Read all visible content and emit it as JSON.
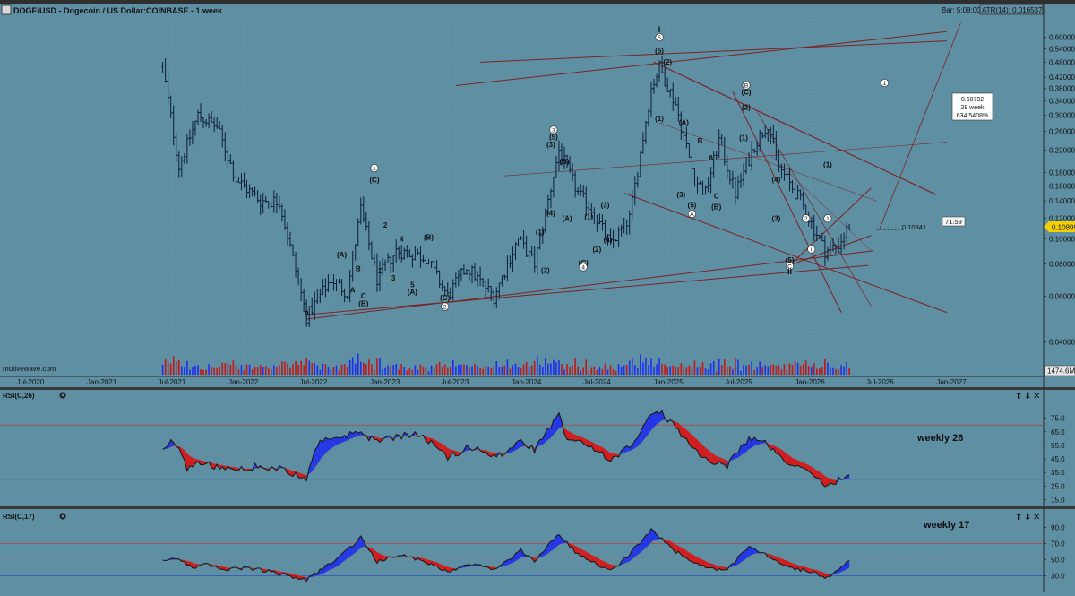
{
  "header": {
    "title": "DOGE/USD - Dogecoin / US Dollar:COINBASE - 1 week",
    "bar_label": "Bar: 5:08:00",
    "atr_label": "ATR(14): 0.016537"
  },
  "watermark": "motivewave.com",
  "colors": {
    "background": "#5f8fa3",
    "candle": "#0b1e3a",
    "channel": "#7a2424",
    "rsi_line": "#1a1a1a",
    "rsi_up": "#1e2ef0",
    "rsi_down": "#e01010",
    "level_line": "#b84040",
    "mid_line": "#2c4fbf"
  },
  "chart_data": [
    {
      "type": "candlestick",
      "title": "DOGE/USD - Dogecoin / US Dollar:COINBASE - 1 week",
      "y_scale": "log",
      "ylim": [
        0.034,
        0.7
      ],
      "x_range": [
        "2020-06-01",
        "2027-02-28"
      ],
      "x_ticks": [
        "Jul-2020",
        "Jan-2021",
        "Jul-2021",
        "Jan-2022",
        "Jul-2022",
        "Jan-2023",
        "Jul-2023",
        "Jan-2024",
        "Jul-2024",
        "Jan-2025",
        "Jul-2025",
        "Jan-2026",
        "Jul-2026",
        "Jan-2027"
      ],
      "y_ticks": [
        "0.04000",
        "0.06000",
        "0.08000",
        "0.10000",
        "0.12000",
        "0.14000",
        "0.16000",
        "0.18000",
        "0.22000",
        "0.26000",
        "0.30000",
        "0.34000",
        "0.38000",
        "0.42000",
        "0.48000",
        "0.54000",
        "0.60000"
      ],
      "price_path": [
        [
          "2021-06-07",
          0.46
        ],
        [
          "2021-07-19",
          0.19
        ],
        [
          "2021-09-06",
          0.3
        ],
        [
          "2021-10-25",
          0.27
        ],
        [
          "2021-12-13",
          0.17
        ],
        [
          "2022-02-14",
          0.14
        ],
        [
          "2022-04-04",
          0.14
        ],
        [
          "2022-06-13",
          0.05
        ],
        [
          "2022-08-15",
          0.07
        ],
        [
          "2022-09-26",
          0.062
        ],
        [
          "2022-10-31",
          0.13
        ],
        [
          "2022-12-12",
          0.07
        ],
        [
          "2023-01-30",
          0.09
        ],
        [
          "2023-04-17",
          0.085
        ],
        [
          "2023-06-12",
          0.06
        ],
        [
          "2023-07-31",
          0.078
        ],
        [
          "2023-10-09",
          0.06
        ],
        [
          "2023-12-11",
          0.1
        ],
        [
          "2024-01-22",
          0.08
        ],
        [
          "2024-03-25",
          0.22
        ],
        [
          "2024-05-13",
          0.15
        ],
        [
          "2024-06-17",
          0.13
        ],
        [
          "2024-08-05",
          0.095
        ],
        [
          "2024-09-23",
          0.12
        ],
        [
          "2024-11-18",
          0.38
        ],
        [
          "2024-12-09",
          0.46
        ],
        [
          "2025-01-20",
          0.33
        ],
        [
          "2025-03-10",
          0.17
        ],
        [
          "2025-04-07",
          0.15
        ],
        [
          "2025-05-12",
          0.24
        ],
        [
          "2025-06-23",
          0.15
        ],
        [
          "2025-08-11",
          0.23
        ],
        [
          "2025-09-15",
          0.28
        ],
        [
          "2025-10-13",
          0.19
        ],
        [
          "2025-12-08",
          0.14
        ],
        [
          "2026-02-09",
          0.09
        ],
        [
          "2026-03-16",
          0.095
        ],
        [
          "2026-04-13",
          0.112
        ]
      ],
      "current_price": "0.10899",
      "level_label": "0.10841",
      "angle_label": "71.59",
      "projection": [
        "0.68792",
        "28 week",
        "634.5408%"
      ],
      "volume_label": "1474.6M",
      "wave_labels": [
        {
          "text": "(A)",
          "x": "2022-09-12",
          "y": 0.085
        },
        {
          "text": "B",
          "x": "2022-10-24",
          "y": 0.075
        },
        {
          "text": "A",
          "x": "2022-10-10",
          "y": 0.062
        },
        {
          "text": "C",
          "x": "2022-11-07",
          "y": 0.059
        },
        {
          "text": "(B)",
          "x": "2022-11-07",
          "y": 0.055
        },
        {
          "text": "0",
          "x": "2022-06-13",
          "y": 0.0505
        },
        {
          "text": "1",
          "x": "2022-12-05",
          "y": 0.183,
          "circled": true
        },
        {
          "text": "(C)",
          "x": "2022-12-05",
          "y": 0.165
        },
        {
          "text": "2",
          "x": "2023-01-02",
          "y": 0.1105
        },
        {
          "text": "1",
          "x": "2022-12-19",
          "y": 0.0735
        },
        {
          "text": "3",
          "x": "2023-01-23",
          "y": 0.069
        },
        {
          "text": "4",
          "x": "2023-02-13",
          "y": 0.0975
        },
        {
          "text": "5",
          "x": "2023-03-13",
          "y": 0.065
        },
        {
          "text": "(A)",
          "x": "2023-03-13",
          "y": 0.061
        },
        {
          "text": "(B)",
          "x": "2023-04-24",
          "y": 0.099
        },
        {
          "text": "(C)",
          "x": "2023-06-05",
          "y": 0.058
        },
        {
          "text": "2",
          "x": "2023-06-05",
          "y": 0.0535,
          "circled": true
        },
        {
          "text": "(1)",
          "x": "2024-02-05",
          "y": 0.104
        },
        {
          "text": "(2)",
          "x": "2024-02-19",
          "y": 0.074
        },
        {
          "text": "3",
          "x": "2024-03-11",
          "y": 0.257,
          "circled": true
        },
        {
          "text": "(5)",
          "x": "2024-03-11",
          "y": 0.242
        },
        {
          "text": "(3)",
          "x": "2024-03-04",
          "y": 0.226
        },
        {
          "text": "(B)",
          "x": "2024-04-08",
          "y": 0.194
        },
        {
          "text": "(4)",
          "x": "2024-03-04",
          "y": 0.123
        },
        {
          "text": "(A)",
          "x": "2024-04-15",
          "y": 0.117
        },
        {
          "text": "(1)",
          "x": "2024-06-10",
          "y": 0.119
        },
        {
          "text": "(3)",
          "x": "2024-07-22",
          "y": 0.132
        },
        {
          "text": "(4)",
          "x": "2024-07-29",
          "y": 0.097
        },
        {
          "text": "(2)",
          "x": "2024-07-01",
          "y": 0.089
        },
        {
          "text": "(C)",
          "x": "2024-05-27",
          "y": 0.079
        },
        {
          "text": "4",
          "x": "2024-05-27",
          "y": 0.076,
          "circled": true
        },
        {
          "text": "I",
          "x": "2024-12-09",
          "y": 0.625
        },
        {
          "text": "5",
          "x": "2024-12-09",
          "y": 0.585,
          "circled": true
        },
        {
          "text": "(5)",
          "x": "2024-12-09",
          "y": 0.52
        },
        {
          "text": "(2)",
          "x": "2024-12-30",
          "y": 0.47
        },
        {
          "text": "(1)",
          "x": "2024-12-09",
          "y": 0.285
        },
        {
          "text": "(A)",
          "x": "2025-02-10",
          "y": 0.275
        },
        {
          "text": "B",
          "x": "2025-03-24",
          "y": 0.233
        },
        {
          "text": "A",
          "x": "2025-04-21",
          "y": 0.201
        },
        {
          "text": "C",
          "x": "2025-05-05",
          "y": 0.143
        },
        {
          "text": "(B)",
          "x": "2025-05-05",
          "y": 0.13
        },
        {
          "text": "(3)",
          "x": "2025-02-03",
          "y": 0.145
        },
        {
          "text": "(5)",
          "x": "2025-03-03",
          "y": 0.132
        },
        {
          "text": "A",
          "x": "2025-03-03",
          "y": 0.122,
          "circled": true
        },
        {
          "text": "B",
          "x": "2025-07-21",
          "y": 0.382,
          "circled": true
        },
        {
          "text": "(C)",
          "x": "2025-07-21",
          "y": 0.36
        },
        {
          "text": "(2)",
          "x": "2025-07-21",
          "y": 0.314
        },
        {
          "text": "(1)",
          "x": "2025-07-14",
          "y": 0.24
        },
        {
          "text": "(4)",
          "x": "2025-10-06",
          "y": 0.166
        },
        {
          "text": "(3)",
          "x": "2025-10-06",
          "y": 0.117
        },
        {
          "text": "(5)",
          "x": "2025-11-10",
          "y": 0.081
        },
        {
          "text": "C",
          "x": "2025-11-10",
          "y": 0.0765,
          "circled": true
        },
        {
          "text": "II",
          "x": "2025-11-10",
          "y": 0.073
        },
        {
          "text": "1",
          "x": "2026-02-16",
          "y": 0.117,
          "circled": true
        },
        {
          "text": "(1)",
          "x": "2026-02-16",
          "y": 0.189
        },
        {
          "text": "2",
          "x": "2025-12-22",
          "y": 0.117,
          "circled": true
        },
        {
          "text": "i",
          "x": "2026-01-05",
          "y": 0.089,
          "circled": true
        },
        {
          "text": "1",
          "x": "2026-07-13",
          "y": 0.39,
          "circled": true
        }
      ]
    },
    {
      "type": "line",
      "title": "RSI(C,26)",
      "annotation": "weekly 26",
      "y_ticks": [
        "15.0",
        "25.0",
        "35.0",
        "45.0",
        "55.0",
        "65.0",
        "75.0"
      ],
      "ylim": [
        12,
        86
      ],
      "levels": {
        "upper": 70,
        "mid": 50,
        "lower": 30
      },
      "series": [
        {
          "values": [
            [
              "2021-06-07",
              52
            ],
            [
              "2021-07-05",
              59
            ],
            [
              "2021-08-09",
              38
            ],
            [
              "2021-09-20",
              43
            ],
            [
              "2021-11-01",
              38
            ],
            [
              "2021-12-13",
              36
            ],
            [
              "2022-02-07",
              40
            ],
            [
              "2022-04-04",
              38
            ],
            [
              "2022-06-13",
              30
            ],
            [
              "2022-07-11",
              56
            ],
            [
              "2022-09-05",
              62
            ],
            [
              "2022-10-31",
              64
            ],
            [
              "2022-12-12",
              58
            ],
            [
              "2023-02-06",
              62
            ],
            [
              "2023-04-03",
              63
            ],
            [
              "2023-06-12",
              46
            ],
            [
              "2023-08-07",
              54
            ],
            [
              "2023-10-16",
              47
            ],
            [
              "2023-12-18",
              58
            ],
            [
              "2024-01-22",
              52
            ],
            [
              "2024-03-25",
              77
            ],
            [
              "2024-04-15",
              60
            ],
            [
              "2024-06-10",
              55
            ],
            [
              "2024-08-05",
              44
            ],
            [
              "2024-09-23",
              54
            ],
            [
              "2024-11-18",
              77
            ],
            [
              "2024-12-09",
              80
            ],
            [
              "2025-01-20",
              68
            ],
            [
              "2025-03-10",
              53
            ],
            [
              "2025-04-14",
              43
            ],
            [
              "2025-06-02",
              40
            ],
            [
              "2025-07-28",
              61
            ],
            [
              "2025-09-15",
              56
            ],
            [
              "2025-10-20",
              45
            ],
            [
              "2025-12-08",
              38
            ],
            [
              "2026-01-19",
              31
            ],
            [
              "2026-02-09",
              24
            ],
            [
              "2026-03-02",
              28
            ],
            [
              "2026-04-13",
              32
            ]
          ]
        }
      ]
    },
    {
      "type": "line",
      "title": "RSI(C,17)",
      "annotation": "weekly 17",
      "y_ticks": [
        "30.0",
        "50.0",
        "70.0",
        "90.0"
      ],
      "ylim": [
        15,
        95
      ],
      "levels": {
        "upper": 70,
        "mid": 50,
        "lower": 30
      },
      "series": [
        {
          "values": [
            [
              "2021-06-07",
              50
            ],
            [
              "2021-07-12",
              52
            ],
            [
              "2021-08-23",
              40
            ],
            [
              "2021-10-04",
              45
            ],
            [
              "2021-11-15",
              38
            ],
            [
              "2022-01-03",
              40
            ],
            [
              "2022-03-07",
              36
            ],
            [
              "2022-06-13",
              25
            ],
            [
              "2022-09-05",
              52
            ],
            [
              "2022-10-31",
              78
            ],
            [
              "2022-12-12",
              48
            ],
            [
              "2023-02-06",
              55
            ],
            [
              "2023-04-03",
              50
            ],
            [
              "2023-06-12",
              35
            ],
            [
              "2023-08-07",
              45
            ],
            [
              "2023-10-16",
              38
            ],
            [
              "2023-12-18",
              62
            ],
            [
              "2024-01-22",
              48
            ],
            [
              "2024-03-25",
              82
            ],
            [
              "2024-05-06",
              60
            ],
            [
              "2024-07-01",
              45
            ],
            [
              "2024-08-05",
              35
            ],
            [
              "2024-09-30",
              60
            ],
            [
              "2024-11-18",
              88
            ],
            [
              "2025-01-20",
              60
            ],
            [
              "2025-03-10",
              45
            ],
            [
              "2025-04-14",
              40
            ],
            [
              "2025-06-02",
              37
            ],
            [
              "2025-07-28",
              66
            ],
            [
              "2025-09-22",
              54
            ],
            [
              "2025-10-20",
              42
            ],
            [
              "2025-12-08",
              38
            ],
            [
              "2026-01-19",
              32
            ],
            [
              "2026-02-16",
              28
            ],
            [
              "2026-03-16",
              38
            ],
            [
              "2026-04-13",
              50
            ]
          ]
        }
      ]
    }
  ]
}
